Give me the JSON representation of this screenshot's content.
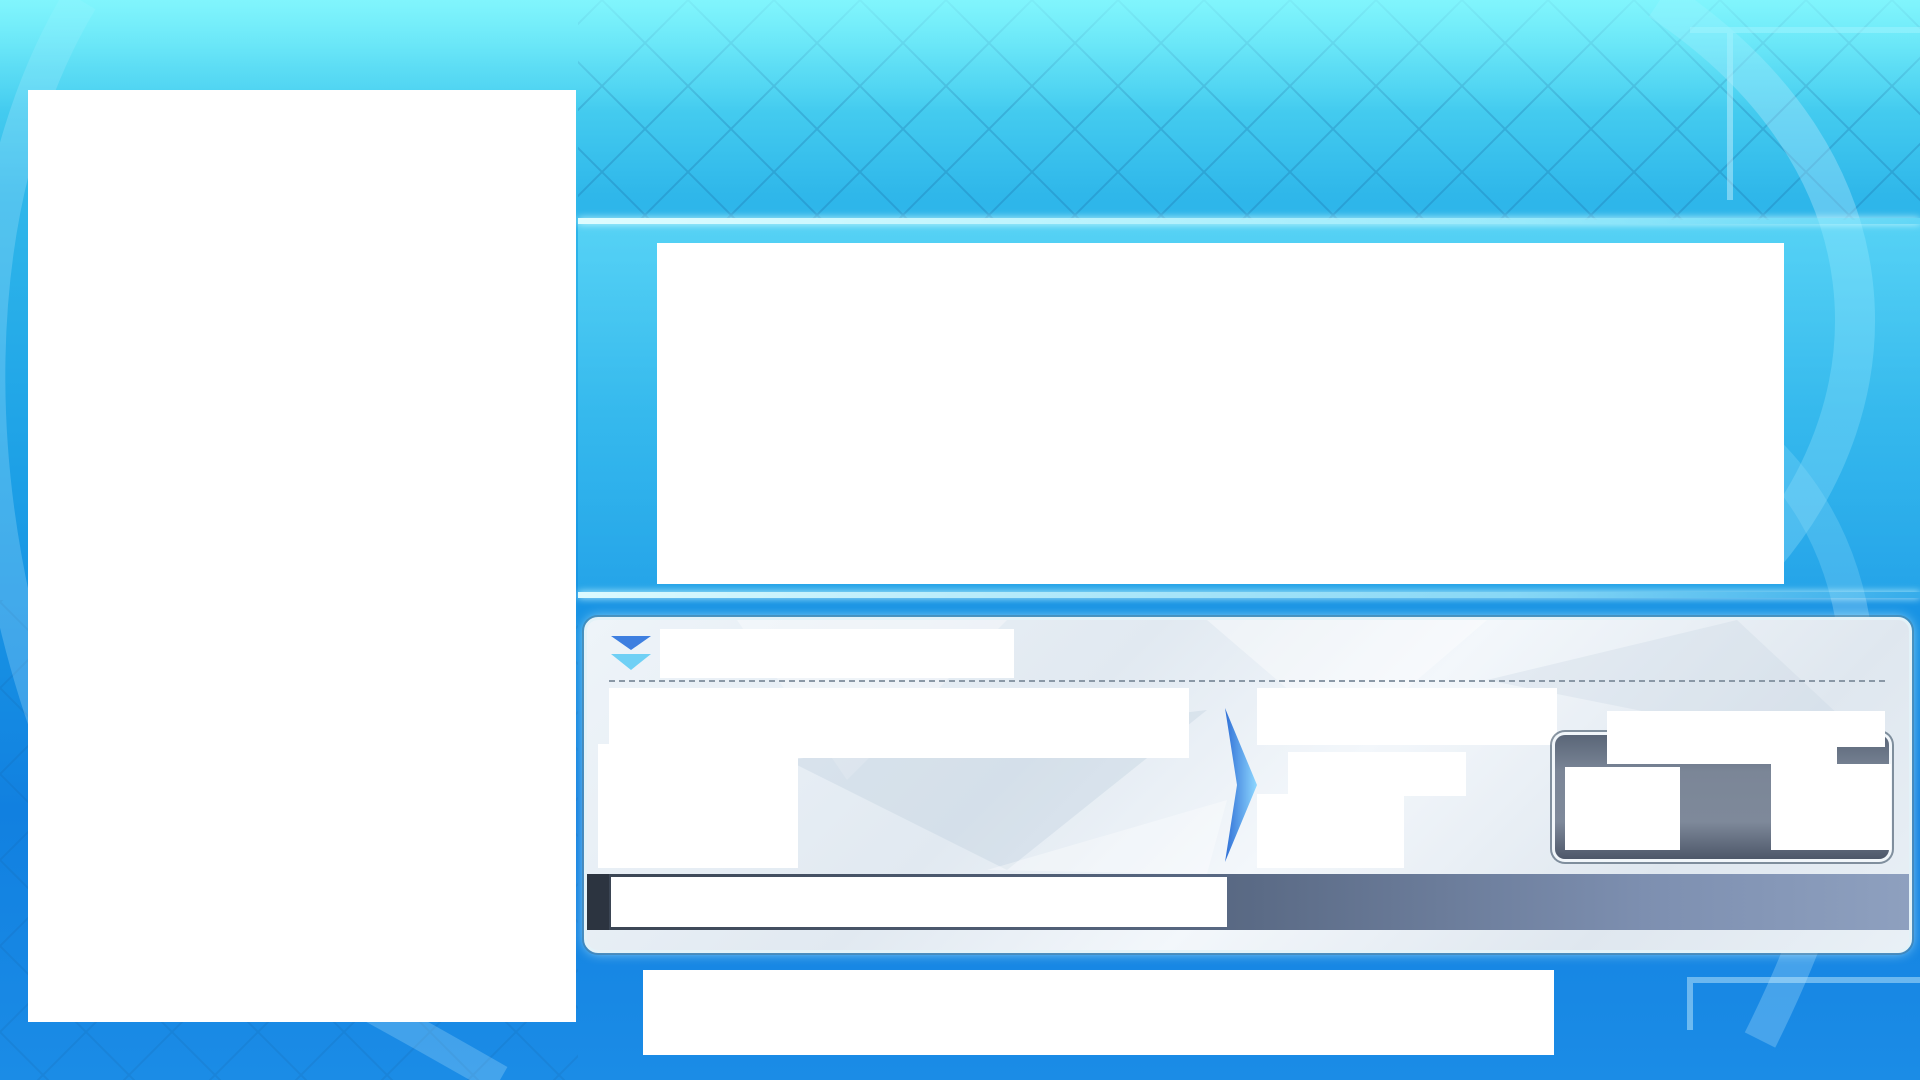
{
  "screen": {
    "background": "#1c9fe6",
    "accent": "#5fe6f6"
  },
  "left_panel": {
    "content": ""
  },
  "main_panel": {
    "content": ""
  },
  "detail_card": {
    "header_icon": "double-chevron-down-icon",
    "header_label": "",
    "left_section": {
      "line_1": "",
      "line_2": ""
    },
    "arrow_icon": "chevron-right-icon",
    "right_section": {
      "line_1": "",
      "line_2": "",
      "line_3": ""
    },
    "slot": {
      "label": "",
      "left_value": "",
      "right_value": ""
    },
    "footer_text": "",
    "footer_color": "#5a6a85"
  },
  "bottom_bar": {
    "text": ""
  }
}
